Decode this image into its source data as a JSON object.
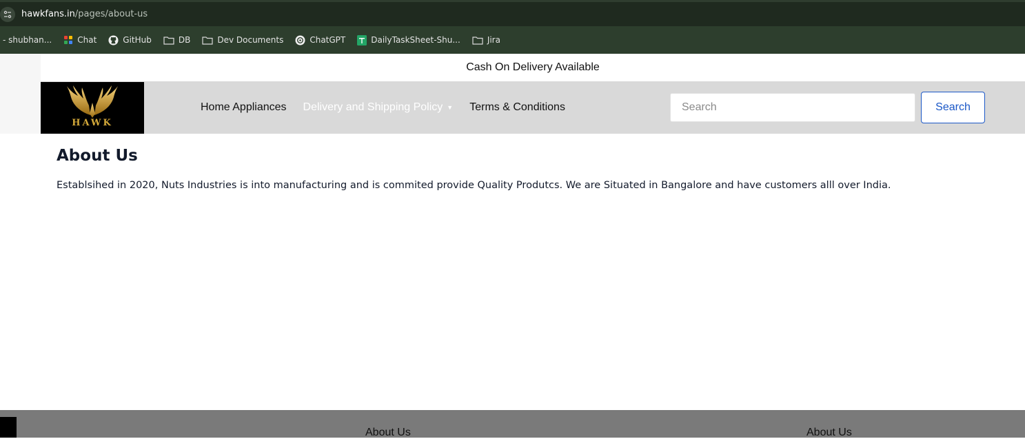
{
  "browser": {
    "url_host": "hawkfans.in",
    "url_path": "/pages/about-us"
  },
  "bookmarks": [
    {
      "label": "- shubhan...",
      "icon": "none"
    },
    {
      "label": "Chat",
      "icon": "chat-icon"
    },
    {
      "label": "GitHub",
      "icon": "github-icon"
    },
    {
      "label": "DB",
      "icon": "folder-icon"
    },
    {
      "label": "Dev Documents",
      "icon": "folder-icon"
    },
    {
      "label": "ChatGPT",
      "icon": "chatgpt-icon"
    },
    {
      "label": "DailyTaskSheet-Shu...",
      "icon": "sheets-icon"
    },
    {
      "label": "Jira",
      "icon": "folder-icon"
    }
  ],
  "announcement": "Cash On Delivery Available",
  "logo": {
    "text": "HAWK",
    "color": "#d4a93a"
  },
  "nav": {
    "items": [
      {
        "label": "Home Appliances"
      },
      {
        "label": "Delivery and Shipping Policy",
        "active": true,
        "has_dropdown": true
      },
      {
        "label": "Terms & Conditions"
      }
    ]
  },
  "search": {
    "placeholder": "Search",
    "button_label": "Search"
  },
  "content": {
    "title": "About Us",
    "body": "Establsihed in 2020, Nuts Industries is into manufacturing and is commited provide Quality Produtcs. We are Situated in Bangalore and have customers alll over India."
  },
  "footer": {
    "links": [
      "About Us",
      "About Us"
    ]
  },
  "colors": {
    "browser_bar": "#1f2a1f",
    "bookmarks_bar": "#2d3e2d",
    "header_bg": "#d9d9d9",
    "accent_blue": "#1a57c7",
    "footer_bg": "#7a7a7a"
  }
}
